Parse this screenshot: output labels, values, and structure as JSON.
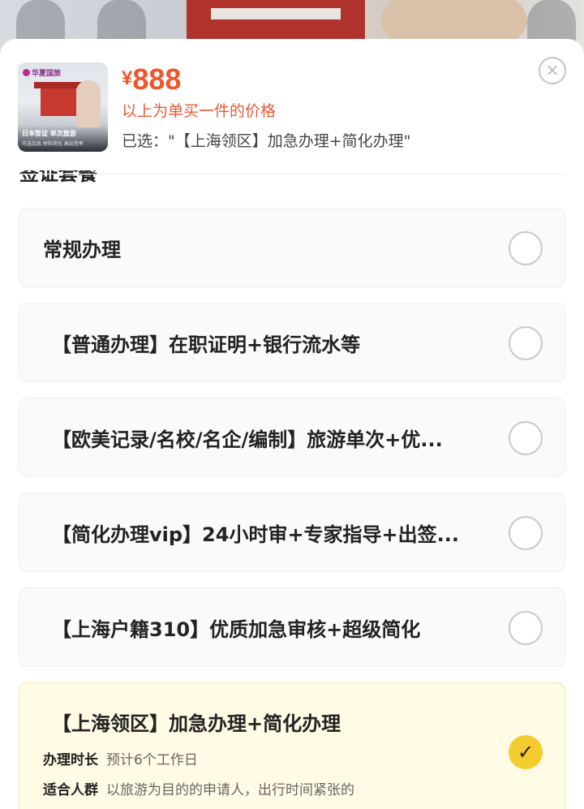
{
  "header": {
    "thumbnail": {
      "logo_text": "华夏国旅",
      "line1": "日本签证 单次旅游",
      "line2": "可选加急  材料简化  高出签率"
    },
    "price_currency": "¥",
    "price_value": "888",
    "price_note": "以上为单买一件的价格",
    "selected_text": "已选：\"【上海领区】加急办理+简化办理\"",
    "close_icon": "close-icon"
  },
  "section": {
    "title": "签证套餐"
  },
  "options": [
    {
      "label": "常规办理",
      "selected": false
    },
    {
      "label": "【普通办理】在职证明+银行流水等",
      "selected": false
    },
    {
      "label": "【欧美记录/名校/名企/编制】旅游单次+优...",
      "selected": false
    },
    {
      "label": "【简化办理vip】24小时审+专家指导+出签...",
      "selected": false
    },
    {
      "label": "【上海户籍310】优质加急审核+超级简化",
      "selected": false
    },
    {
      "label": "【上海领区】加急办理+简化办理",
      "selected": true,
      "details": [
        {
          "key": "办理时长",
          "value": "预计6个工作日"
        },
        {
          "key": "适合人群",
          "value": "以旅游为目的的申请人，出行时间紧张的"
        }
      ],
      "check_icon": "check-icon"
    }
  ],
  "colors": {
    "price": "#f0552c",
    "selected_bg": "#fffbe4",
    "check_fill": "#f5cc2f"
  }
}
